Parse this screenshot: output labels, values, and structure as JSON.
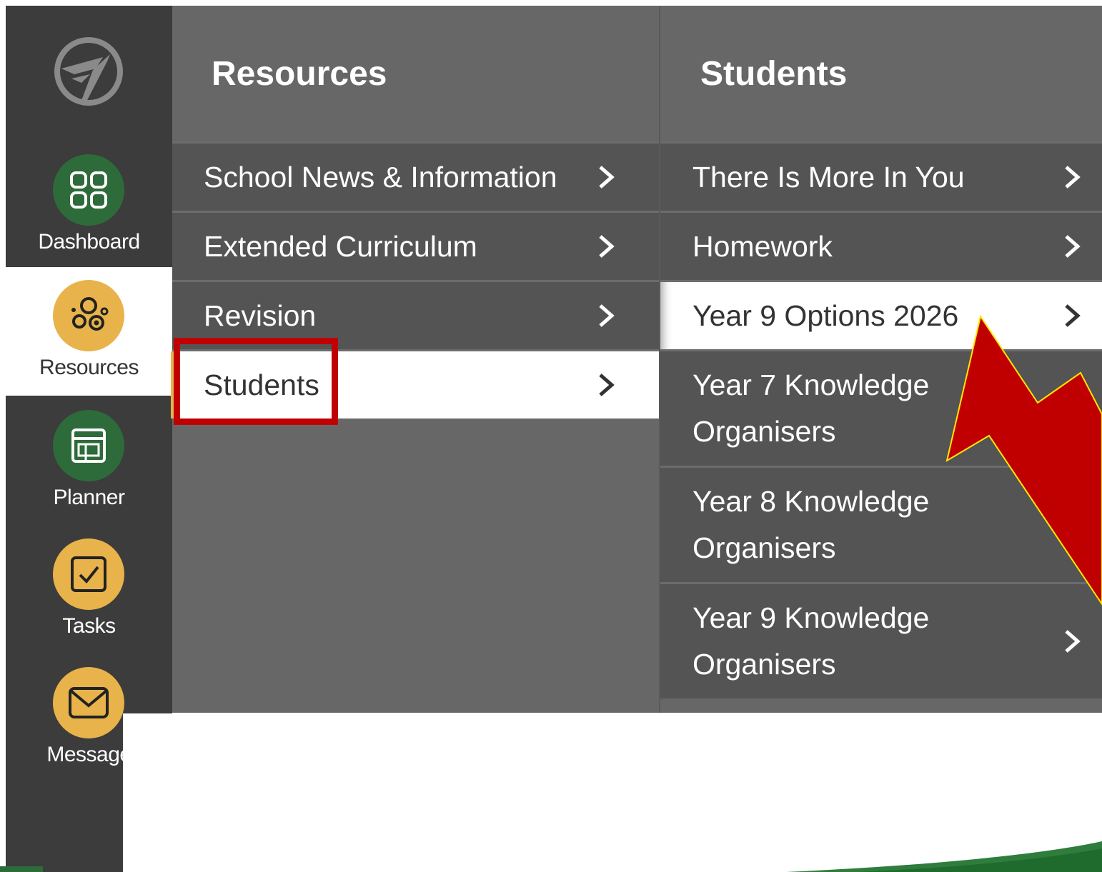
{
  "sidebar": {
    "items": [
      {
        "label": "Dashboard",
        "icon": "dashboard-grid-icon",
        "color": "#2e6b3a"
      },
      {
        "label": "Resources",
        "icon": "resources-circles-icon",
        "color": "#e8b34a",
        "active": true
      },
      {
        "label": "Planner",
        "icon": "planner-icon",
        "color": "#2e6b3a"
      },
      {
        "label": "Tasks",
        "icon": "checkbox-icon",
        "color": "#e8b34a"
      },
      {
        "label": "Message",
        "icon": "envelope-icon",
        "color": "#e8b34a"
      }
    ]
  },
  "resources_panel": {
    "title": "Resources",
    "items": [
      {
        "label": "School News & Information"
      },
      {
        "label": "Extended Curriculum"
      },
      {
        "label": "Revision"
      },
      {
        "label": "Students",
        "selected": true
      }
    ]
  },
  "students_panel": {
    "title": "Students",
    "items": [
      {
        "label": "There Is More In You"
      },
      {
        "label": "Homework"
      },
      {
        "label": "Year 9 Options 2026",
        "selected": true
      },
      {
        "label": "Year 7 Knowledge Organisers"
      },
      {
        "label": "Year 8 Knowledge Organisers"
      },
      {
        "label": "Year 9 Knowledge Organisers"
      }
    ]
  },
  "colors": {
    "rail_bg": "#3c3c3c",
    "panel_bg": "#676767",
    "menu_item_bg": "#545454",
    "accent_gold": "#e8b34a",
    "accent_green": "#2e6b3a",
    "annotation_red": "#c00000"
  }
}
